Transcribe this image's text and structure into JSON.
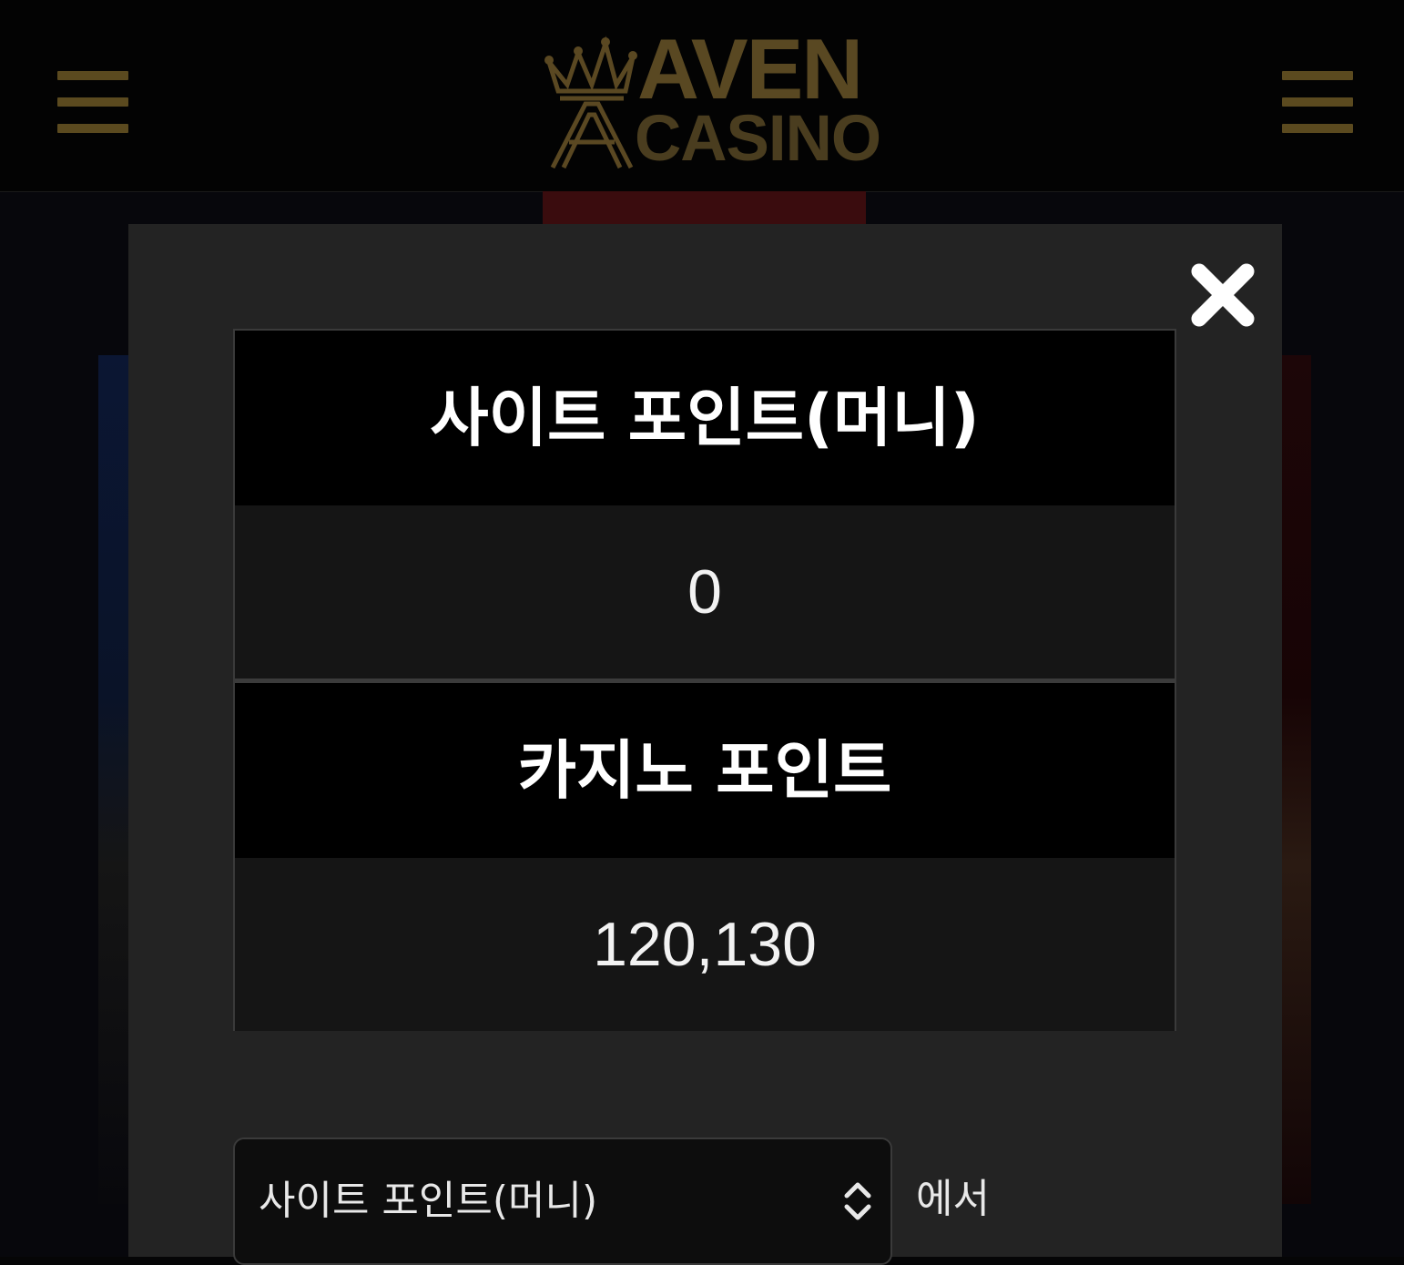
{
  "header": {
    "logo_line1": "AVEN",
    "logo_line2": "CASINO",
    "menu_left_icon": "hamburger-icon",
    "menu_right_icon": "hamburger-icon"
  },
  "modal": {
    "close_icon": "close-icon",
    "site_points": {
      "label": "사이트 포인트(머니)",
      "value": "0"
    },
    "casino_points": {
      "label": "카지노 포인트",
      "value": "120,130"
    },
    "transfer": {
      "source_selected": "사이트 포인트(머니)",
      "source_suffix": "에서"
    }
  },
  "colors": {
    "modal_bg": "#232323",
    "header_bg": "#000000",
    "value_bg": "#151515",
    "logo_gold": "#594822"
  }
}
